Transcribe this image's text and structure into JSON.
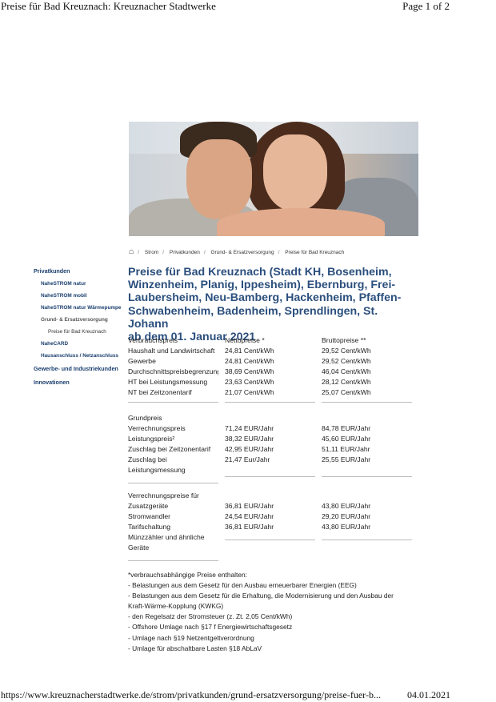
{
  "print_header": {
    "title": "Preise für Bad Kreuznach: Kreuznacher Stadtwerke",
    "page": "Page 1 of 2"
  },
  "print_footer": {
    "url": "https://www.kreuznacherstadtwerke.de/strom/privatkunden/grund-ersatzversorgung/preise-fuer-b...",
    "date": "04.01.2021"
  },
  "breadcrumb": {
    "home_icon": "home-icon",
    "items": [
      "Strom",
      "Privatkunden",
      "Grund- & Ersatzversorgung",
      "Preise für Bad Kreuznach"
    ]
  },
  "sidebar": {
    "items": [
      {
        "label": "Privatkunden"
      },
      {
        "label": "NaheSTROM natur"
      },
      {
        "label": "NaheSTROM mobil"
      },
      {
        "label": "NaheSTROM natur Wärmepumpe"
      },
      {
        "label": "Grund- & Ersatzversorgung"
      },
      {
        "label": "Preise für Bad Kreuznach"
      },
      {
        "label": "NaheCARD"
      },
      {
        "label": "Hausanschluss / Netzanschluss"
      },
      {
        "label": "Gewerbe- und Industriekunden"
      },
      {
        "label": "Innovationen"
      }
    ]
  },
  "heading": "Preise für Bad Kreuznach (Stadt KH, Bosenheim, Winzenheim, Planig, Ippesheim), Ebernburg, Frei-Laubersheim, Neu-Bamberg, Hackenheim, Pfaffen-Schwabenheim, Badenheim, Sprendlingen, St. Johann ab dem 01. Januar 2021",
  "heading_lines": [
    "Preise für Bad Kreuznach (Stadt KH, Bosenheim,",
    "Winzenheim, Planig, Ippesheim), Ebernburg, Frei-",
    "Laubersheim, Neu-Bamberg, Hackenheim, Pfaffen-",
    "Schwabenheim, Badenheim, Sprendlingen, St. Johann",
    "ab dem 01. Januar 2021"
  ],
  "table1": {
    "headers": [
      "Verbrauchspreis",
      "Nettopreise *",
      "Bruttopreise **"
    ],
    "rows": [
      [
        "Haushalt und Landwirtschaft",
        "24,81 Cent/kWh",
        "29,52 Cent/kWh"
      ],
      [
        "Gewerbe",
        "24,81 Cent/kWh",
        "29,52 Cent/kWh"
      ],
      [
        "Durchschnittspreisbegrenzung",
        "38,69 Cent/kWh",
        "46,04 Cent/kWh"
      ],
      [
        "HT bei Leistungsmessung",
        "23,63 Cent/kWh",
        "28,12 Cent/kWh"
      ],
      [
        "NT bei Zeitzonentarif",
        "21,07 Cent/kWh",
        "25,07 Cent/kWh"
      ]
    ]
  },
  "table2": {
    "title": "Grundpreis",
    "rows": [
      [
        "Verrechnungspreis",
        "71,24 EUR/Jahr",
        "84,78 EUR/Jahr"
      ],
      [
        "Leistungspreis²",
        "38,32 EUR/Jahr",
        "45,60 EUR/Jahr"
      ],
      [
        "Zuschlag bei Zeitzonentarif",
        "42,95 EUR/Jahr",
        "51,11 EUR/Jahr"
      ],
      [
        "Zuschlag bei",
        "21,47 Eur/Jahr",
        "25,55 EUR/Jahr"
      ],
      [
        "Leistungsmessung",
        "",
        ""
      ]
    ]
  },
  "table3": {
    "title": "Verrechnungspreise für",
    "rows": [
      [
        "Zusatzgeräte",
        "36,81 EUR/Jahr",
        "43,80 EUR/Jahr"
      ],
      [
        "Stromwandler",
        "24,54 EUR/Jahr",
        "29,20 EUR/Jahr"
      ],
      [
        "Tarifschaltung",
        "36,81 EUR/Jahr",
        "43,80 EUR/Jahr"
      ],
      [
        "Münzzähler und ähnliche",
        "",
        ""
      ],
      [
        "Geräte",
        "",
        ""
      ]
    ]
  },
  "notes": [
    "*verbrauchsabhängige Preise enthalten:",
    "- Belastungen aus dem Gesetz für den Ausbau erneuerbarer Energien (EEG)",
    "- Belastungen aus dem Gesetz für die Erhaltung, die Modernisierung und den Ausbau der",
    "Kraft-Wärme-Kopplung (KWKG)",
    "- den Regelsatz der Stromsteuer (z. Zt. 2,05 Cent/kWh)",
    "- Offshore Umlage nach §17 f Energiewirtschaftsgesetz",
    "- Umlage nach §19 Netzentgeltverordnung",
    "- Umlage für abschaltbare Lasten §18 AbLaV"
  ]
}
